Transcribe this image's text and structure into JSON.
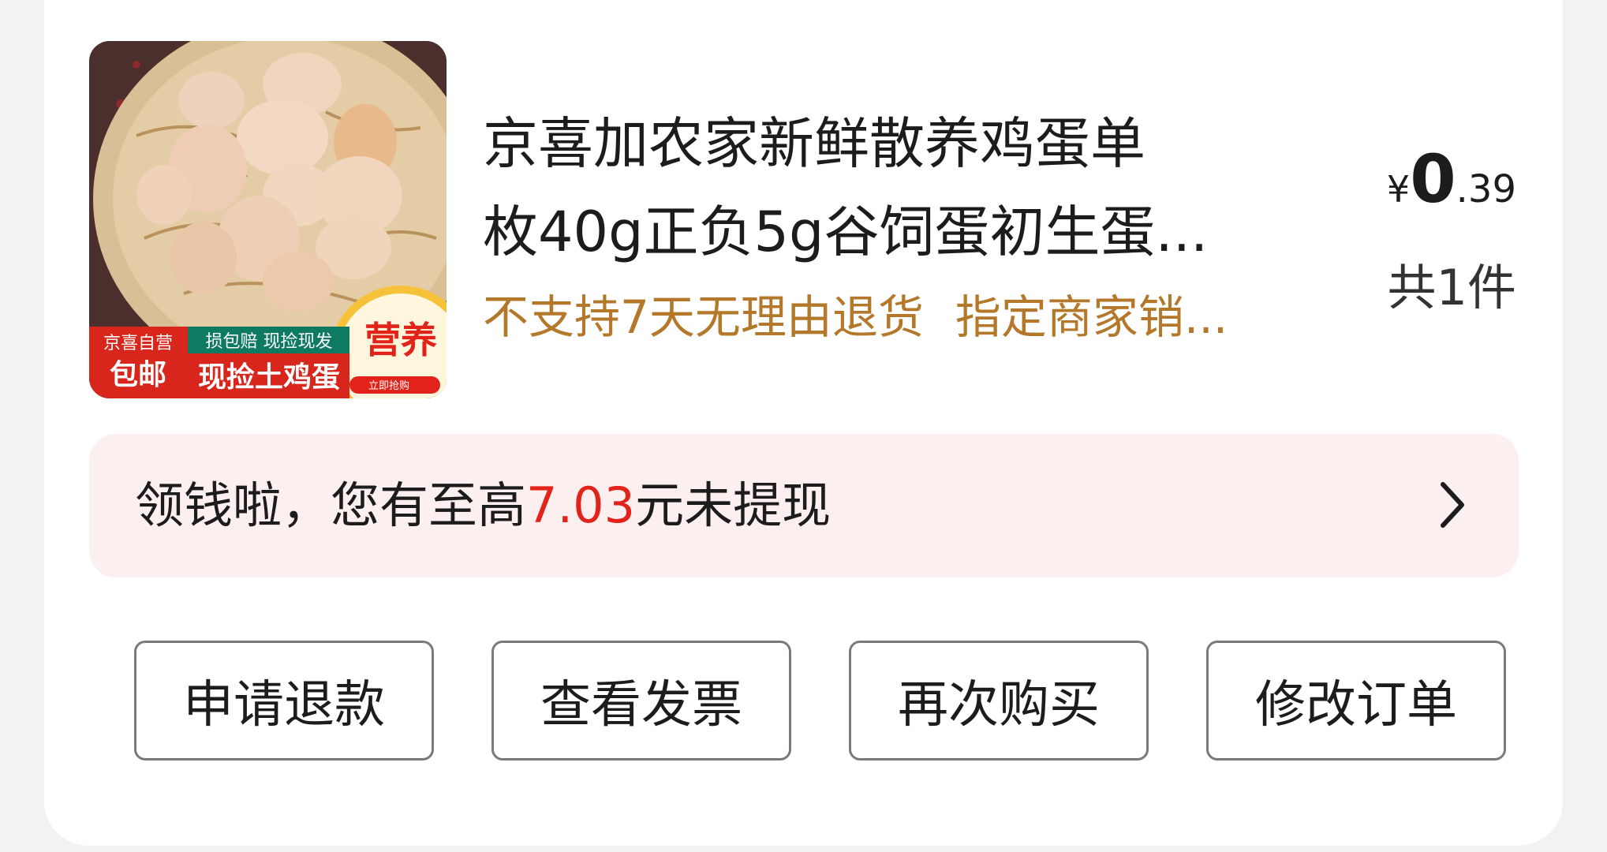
{
  "product": {
    "title_line1": "京喜加农家新鲜散养鸡蛋单",
    "title_line2": "枚40g正负5g谷饲蛋初生蛋...",
    "tags": [
      "不支持7天无理由退货",
      "指定商家销..."
    ],
    "image": {
      "badge_top_left": "京喜自营",
      "badge_mail": "包邮",
      "badge_strip": "损包赔 现捡现发",
      "badge_main": "现捡土鸡蛋",
      "badge_nutrition": "营养",
      "badge_buy": "立即抢购"
    }
  },
  "price": {
    "symbol": "¥",
    "integer": "0",
    "decimal": ".39"
  },
  "quantity_text": "共1件",
  "cash_banner": {
    "prefix": "领钱啦，您有至高",
    "amount": "7.03",
    "suffix": "元未提现"
  },
  "actions": [
    "申请退款",
    "查看发票",
    "再次购买",
    "修改订单"
  ],
  "colors": {
    "accent_red": "#e2231a",
    "tag_gold": "#b3782a",
    "banner_bg": "#fcefef"
  }
}
